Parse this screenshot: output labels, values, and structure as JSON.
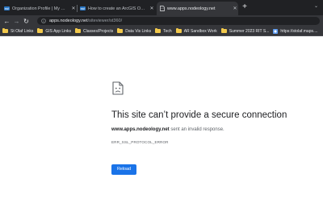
{
  "tabs": [
    {
      "label": "Organization Profile | My Esri",
      "icon": "esri-icon",
      "active": false
    },
    {
      "label": "How to create an ArcGIS Online Dashboard",
      "icon": "esri-icon",
      "active": false
    },
    {
      "label": "www.apps.nodeology.net",
      "icon": "sad-document-icon",
      "active": true
    }
  ],
  "toolbar": {
    "url_host": "apps.nodeology.net",
    "url_path": "/siteviewer/st360/"
  },
  "bookmarks": [
    {
      "label": "St Olaf Links",
      "icon": "folder-icon"
    },
    {
      "label": "GIS App Links",
      "icon": "folder-icon"
    },
    {
      "label": "Classes/Projects",
      "icon": "folder-icon"
    },
    {
      "label": "Data Vis Links",
      "icon": "folder-icon"
    },
    {
      "label": "Tech",
      "icon": "folder-icon"
    },
    {
      "label": "AR Sandbox Work",
      "icon": "folder-icon"
    },
    {
      "label": "Summer 2023 RIT S...",
      "icon": "folder-icon"
    },
    {
      "label": "https://stolaf.maps....",
      "icon": "site-icon"
    }
  ],
  "error": {
    "title": "This site can’t provide a secure connection",
    "host": "www.apps.nodeology.net",
    "message": " sent an invalid response.",
    "code": "ERR_SSL_PROTOCOL_ERROR",
    "reload_label": "Reload"
  },
  "colors": {
    "chrome_dark": "#202124",
    "chrome_toolbar": "#35363a",
    "reload_blue": "#1a73e8"
  }
}
